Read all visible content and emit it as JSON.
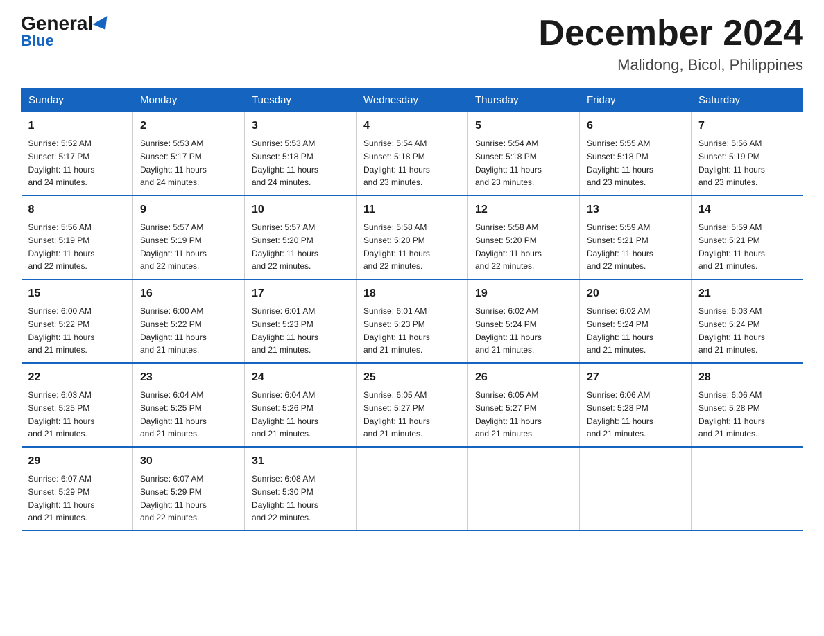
{
  "logo": {
    "text_general": "General",
    "text_blue": "Blue",
    "tagline": ""
  },
  "header": {
    "month_year": "December 2024",
    "location": "Malidong, Bicol, Philippines"
  },
  "days_of_week": [
    "Sunday",
    "Monday",
    "Tuesday",
    "Wednesday",
    "Thursday",
    "Friday",
    "Saturday"
  ],
  "weeks": [
    [
      {
        "day": "1",
        "sunrise": "5:52 AM",
        "sunset": "5:17 PM",
        "daylight": "11 hours and 24 minutes."
      },
      {
        "day": "2",
        "sunrise": "5:53 AM",
        "sunset": "5:17 PM",
        "daylight": "11 hours and 24 minutes."
      },
      {
        "day": "3",
        "sunrise": "5:53 AM",
        "sunset": "5:18 PM",
        "daylight": "11 hours and 24 minutes."
      },
      {
        "day": "4",
        "sunrise": "5:54 AM",
        "sunset": "5:18 PM",
        "daylight": "11 hours and 23 minutes."
      },
      {
        "day": "5",
        "sunrise": "5:54 AM",
        "sunset": "5:18 PM",
        "daylight": "11 hours and 23 minutes."
      },
      {
        "day": "6",
        "sunrise": "5:55 AM",
        "sunset": "5:18 PM",
        "daylight": "11 hours and 23 minutes."
      },
      {
        "day": "7",
        "sunrise": "5:56 AM",
        "sunset": "5:19 PM",
        "daylight": "11 hours and 23 minutes."
      }
    ],
    [
      {
        "day": "8",
        "sunrise": "5:56 AM",
        "sunset": "5:19 PM",
        "daylight": "11 hours and 22 minutes."
      },
      {
        "day": "9",
        "sunrise": "5:57 AM",
        "sunset": "5:19 PM",
        "daylight": "11 hours and 22 minutes."
      },
      {
        "day": "10",
        "sunrise": "5:57 AM",
        "sunset": "5:20 PM",
        "daylight": "11 hours and 22 minutes."
      },
      {
        "day": "11",
        "sunrise": "5:58 AM",
        "sunset": "5:20 PM",
        "daylight": "11 hours and 22 minutes."
      },
      {
        "day": "12",
        "sunrise": "5:58 AM",
        "sunset": "5:20 PM",
        "daylight": "11 hours and 22 minutes."
      },
      {
        "day": "13",
        "sunrise": "5:59 AM",
        "sunset": "5:21 PM",
        "daylight": "11 hours and 22 minutes."
      },
      {
        "day": "14",
        "sunrise": "5:59 AM",
        "sunset": "5:21 PM",
        "daylight": "11 hours and 21 minutes."
      }
    ],
    [
      {
        "day": "15",
        "sunrise": "6:00 AM",
        "sunset": "5:22 PM",
        "daylight": "11 hours and 21 minutes."
      },
      {
        "day": "16",
        "sunrise": "6:00 AM",
        "sunset": "5:22 PM",
        "daylight": "11 hours and 21 minutes."
      },
      {
        "day": "17",
        "sunrise": "6:01 AM",
        "sunset": "5:23 PM",
        "daylight": "11 hours and 21 minutes."
      },
      {
        "day": "18",
        "sunrise": "6:01 AM",
        "sunset": "5:23 PM",
        "daylight": "11 hours and 21 minutes."
      },
      {
        "day": "19",
        "sunrise": "6:02 AM",
        "sunset": "5:24 PM",
        "daylight": "11 hours and 21 minutes."
      },
      {
        "day": "20",
        "sunrise": "6:02 AM",
        "sunset": "5:24 PM",
        "daylight": "11 hours and 21 minutes."
      },
      {
        "day": "21",
        "sunrise": "6:03 AM",
        "sunset": "5:24 PM",
        "daylight": "11 hours and 21 minutes."
      }
    ],
    [
      {
        "day": "22",
        "sunrise": "6:03 AM",
        "sunset": "5:25 PM",
        "daylight": "11 hours and 21 minutes."
      },
      {
        "day": "23",
        "sunrise": "6:04 AM",
        "sunset": "5:25 PM",
        "daylight": "11 hours and 21 minutes."
      },
      {
        "day": "24",
        "sunrise": "6:04 AM",
        "sunset": "5:26 PM",
        "daylight": "11 hours and 21 minutes."
      },
      {
        "day": "25",
        "sunrise": "6:05 AM",
        "sunset": "5:27 PM",
        "daylight": "11 hours and 21 minutes."
      },
      {
        "day": "26",
        "sunrise": "6:05 AM",
        "sunset": "5:27 PM",
        "daylight": "11 hours and 21 minutes."
      },
      {
        "day": "27",
        "sunrise": "6:06 AM",
        "sunset": "5:28 PM",
        "daylight": "11 hours and 21 minutes."
      },
      {
        "day": "28",
        "sunrise": "6:06 AM",
        "sunset": "5:28 PM",
        "daylight": "11 hours and 21 minutes."
      }
    ],
    [
      {
        "day": "29",
        "sunrise": "6:07 AM",
        "sunset": "5:29 PM",
        "daylight": "11 hours and 21 minutes."
      },
      {
        "day": "30",
        "sunrise": "6:07 AM",
        "sunset": "5:29 PM",
        "daylight": "11 hours and 22 minutes."
      },
      {
        "day": "31",
        "sunrise": "6:08 AM",
        "sunset": "5:30 PM",
        "daylight": "11 hours and 22 minutes."
      },
      null,
      null,
      null,
      null
    ]
  ],
  "labels": {
    "sunrise": "Sunrise:",
    "sunset": "Sunset:",
    "daylight": "Daylight:"
  }
}
